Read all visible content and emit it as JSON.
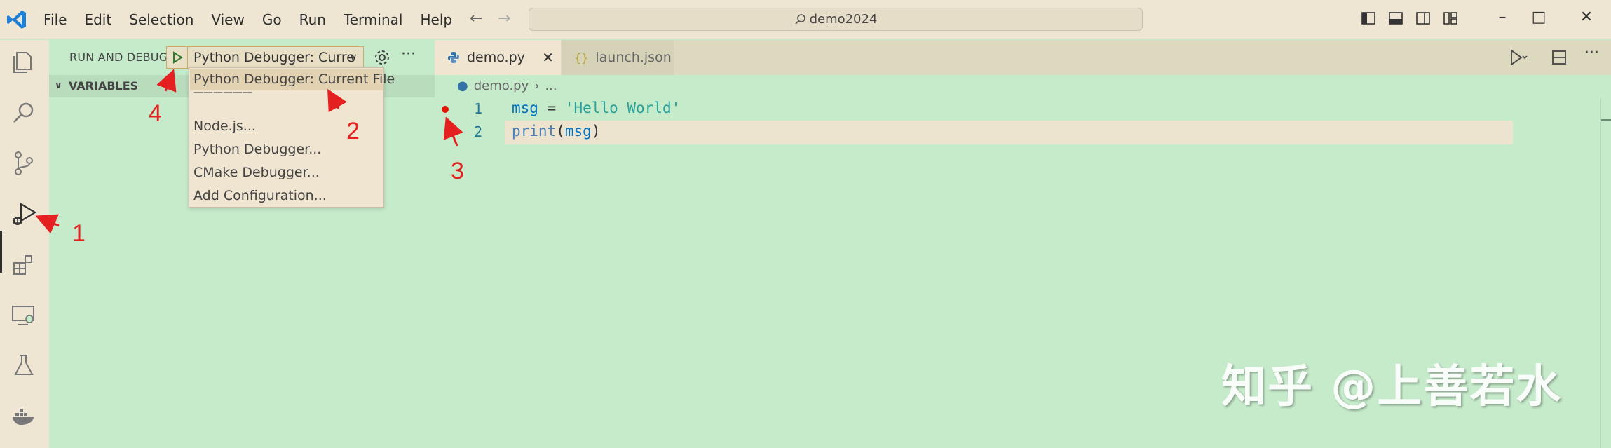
{
  "menu": [
    "File",
    "Edit",
    "Selection",
    "View",
    "Go",
    "Run",
    "Terminal",
    "Help"
  ],
  "search": {
    "text": "demo2024"
  },
  "sidebar": {
    "title": "RUN AND DEBUG",
    "config_selected": "Python Debugger: Curre",
    "variables_label": "VARIABLES"
  },
  "dropdown": {
    "items": [
      "Python Debugger: Current File",
      "Node.js...",
      "Python Debugger...",
      "CMake Debugger...",
      "Add Configuration..."
    ],
    "separator": "——————"
  },
  "tabs": [
    {
      "label": "demo.py",
      "active": true
    },
    {
      "label": "launch.json",
      "active": false
    }
  ],
  "breadcrumb": {
    "file": "demo.py",
    "more": "..."
  },
  "editor": {
    "line_numbers": [
      "1",
      "2"
    ],
    "lines": [
      {
        "var": "msg",
        "op": " = ",
        "str": "'Hello World'"
      },
      {
        "fn": "print",
        "open": "(",
        "arg": "msg",
        "close": ")"
      }
    ]
  },
  "annotations": [
    "1",
    "2",
    "3",
    "4"
  ],
  "watermark": "知乎 @上善若水",
  "colors": {
    "accent_red": "#e42020",
    "breakpoint": "#e51400",
    "background": "#c6ebcb",
    "chrome": "#eee5d2"
  }
}
